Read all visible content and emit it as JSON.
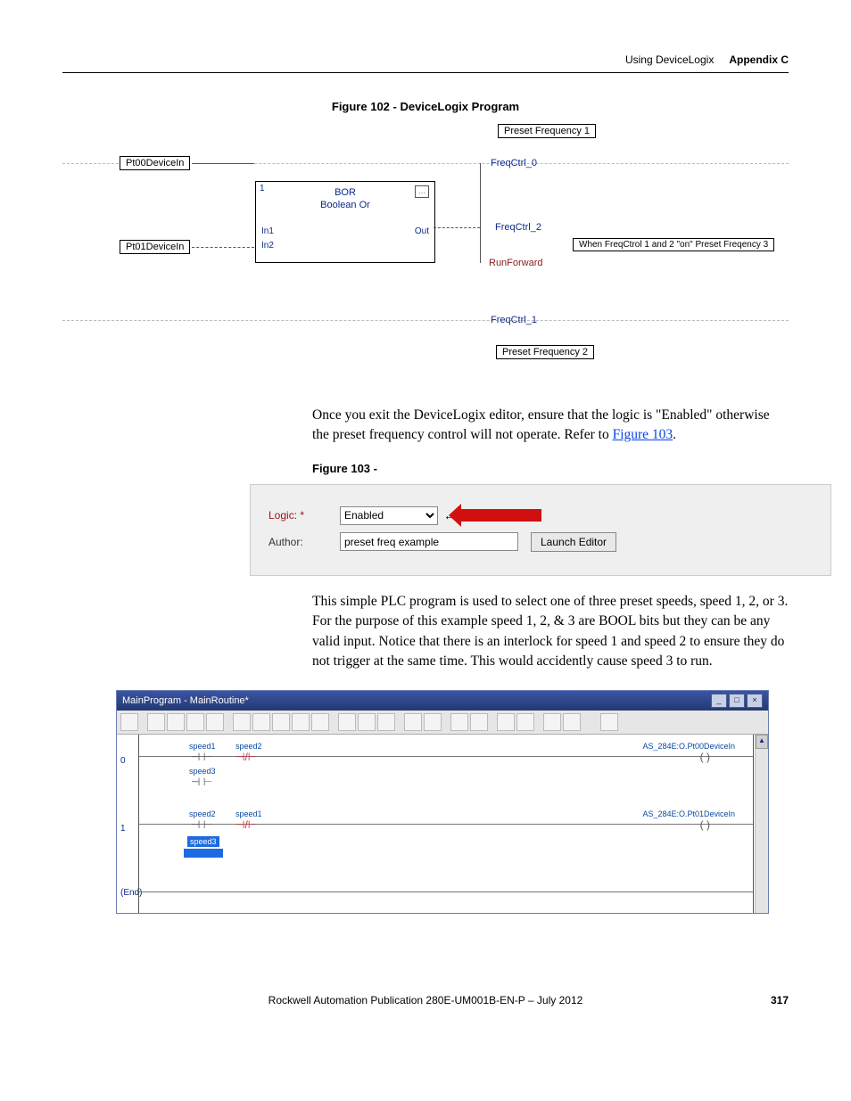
{
  "header": {
    "section": "Using DeviceLogix",
    "appendix": "Appendix C"
  },
  "figure102": {
    "caption": "Figure 102 - DeviceLogix Program",
    "tags": {
      "pt00": "Pt00DeviceIn",
      "pt01": "Pt01DeviceIn",
      "preset1": "Preset Frequency 1",
      "preset2": "Preset Frequency 2",
      "freq0": "FreqCtrl_0",
      "freq1": "FreqCtrl_1",
      "freq2": "FreqCtrl_2",
      "runfwd": "RunForward",
      "note": "When FreqCtrol 1 and 2 \"on\" Preset Freqency 3"
    },
    "bor": {
      "num": "1",
      "title": "BOR",
      "sub": "Boolean Or",
      "in1": "In1",
      "in2": "In2",
      "out": "Out"
    }
  },
  "para1": {
    "text_a": "Once you exit the DeviceLogix editor, ensure that the logic is \"Enabled\" otherwise the preset frequency control will not operate. Refer to ",
    "link": "Figure 103",
    "text_b": "."
  },
  "figure103": {
    "caption": "Figure 103 -",
    "logic_label": "Logic: *",
    "logic_value": "Enabled",
    "author_label": "Author:",
    "author_value": "preset freq example",
    "launch_btn": "Launch Editor"
  },
  "para2": "This simple PLC program is used to select one of three preset speeds, speed 1, 2, or 3. For the purpose of this example speed 1, 2, & 3 are BOOL bits but they can be any valid input. Notice that there is an interlock for speed 1 and speed 2 to ensure they do not trigger at the same time. This would accidently cause speed 3 to run.",
  "ladder": {
    "title": "MainProgram - MainRoutine*",
    "rung0": {
      "num": "0",
      "t1": "speed1",
      "t2": "speed2",
      "t3": "speed3",
      "out": "AS_284E:O.Pt00DeviceIn"
    },
    "rung1": {
      "num": "1",
      "t1": "speed2",
      "t2": "speed1",
      "t3": "speed3",
      "out": "AS_284E:O.Pt01DeviceIn"
    },
    "end": "(End)"
  },
  "footer": {
    "pub": "Rockwell Automation Publication 280E-UM001B-EN-P – July 2012",
    "page": "317"
  }
}
